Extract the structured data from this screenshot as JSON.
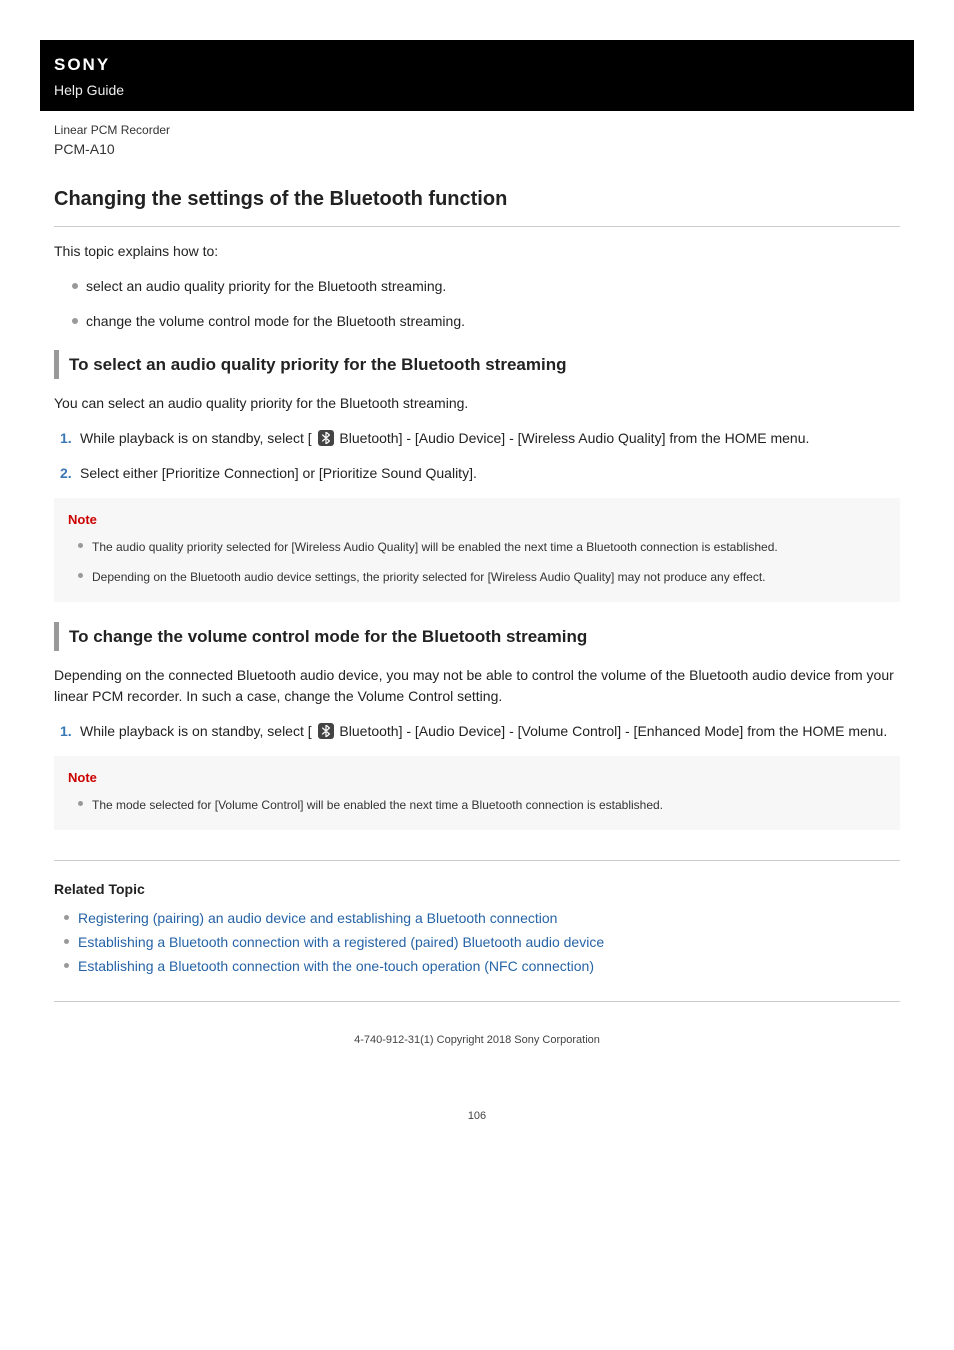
{
  "header": {
    "brand": "SONY",
    "guide": "Help Guide"
  },
  "product": {
    "category": "Linear PCM Recorder",
    "model": "PCM-A10"
  },
  "title": "Changing the settings of the Bluetooth function",
  "intro": "This topic explains how to:",
  "intro_bullets": [
    "select an audio quality priority for the Bluetooth streaming.",
    "change the volume control mode for the Bluetooth streaming."
  ],
  "section1": {
    "heading": "To select an audio quality priority for the Bluetooth streaming",
    "desc": "You can select an audio quality priority for the Bluetooth streaming.",
    "step1_prefix": "While playback is on standby, select [ ",
    "step1_suffix": " Bluetooth] - [Audio Device] - [Wireless Audio Quality] from the HOME menu.",
    "step2": "Select either [Prioritize Connection] or [Prioritize Sound Quality].",
    "note_title": "Note",
    "notes": [
      "The audio quality priority selected for [Wireless Audio Quality] will be enabled the next time a Bluetooth connection is established.",
      "Depending on the Bluetooth audio device settings, the priority selected for [Wireless Audio Quality] may not produce any effect."
    ]
  },
  "section2": {
    "heading": "To change the volume control mode for the Bluetooth streaming",
    "desc": "Depending on the connected Bluetooth audio device, you may not be able to control the volume of the Bluetooth audio device from your linear PCM recorder. In such a case, change the Volume Control setting.",
    "step1_prefix": "While playback is on standby, select [ ",
    "step1_suffix": " Bluetooth] - [Audio Device] - [Volume Control] - [Enhanced Mode] from the HOME menu.",
    "note_title": "Note",
    "notes": [
      "The mode selected for [Volume Control] will be enabled the next time a Bluetooth connection is established."
    ]
  },
  "related": {
    "title": "Related Topic",
    "links": [
      "Registering (pairing) an audio device and establishing a Bluetooth connection",
      "Establishing a Bluetooth connection with a registered (paired) Bluetooth audio device",
      "Establishing a Bluetooth connection with the one-touch operation (NFC connection)"
    ]
  },
  "copyright": "4-740-912-31(1) Copyright 2018 Sony Corporation",
  "page_number": "106"
}
